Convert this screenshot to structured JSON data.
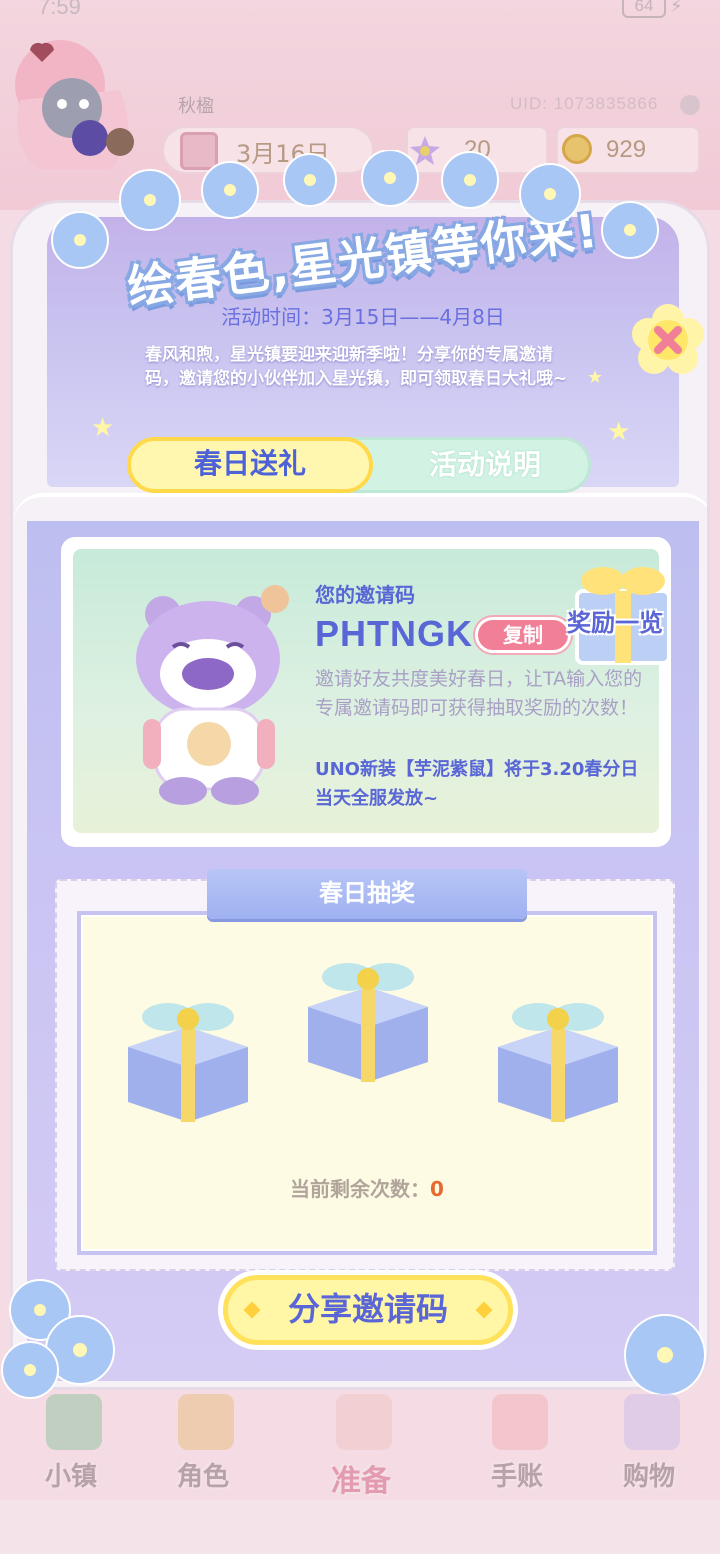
{
  "status": {
    "time": "7:59",
    "battery": "64"
  },
  "hud": {
    "username": "秋楹",
    "uid": "UID: 1073835866",
    "date": "3月16日",
    "gems": "20",
    "coins": "929"
  },
  "event": {
    "title": "绘春色,星光镇等你来!",
    "time": "活动时间：3月15日——4月8日",
    "intro": "春风和煦，星光镇要迎来迎新季啦！分享你的专属邀请码，邀请您的小伙伴加入星光镇，即可领取春日大礼哦~"
  },
  "tabs": {
    "active": "春日送礼",
    "inactive": "活动说明"
  },
  "invite": {
    "label": "您的邀请码",
    "code": "PHTNGK",
    "copy": "复制",
    "desc": "邀请好友共度美好春日，让TA输入您的专属邀请码即可获得抽取奖励的次数！",
    "note": "UNO新装【芋泥紫鼠】将于3.20春分日当天全服发放~"
  },
  "lottery": {
    "title": "春日抽奖",
    "reward_list": "奖励一览",
    "remain_label": "当前剩余次数：",
    "remain_count": "0"
  },
  "share_button": "分享邀请码",
  "nav": {
    "town": "小镇",
    "character": "角色",
    "prepare": "准备",
    "journal": "手账",
    "shop": "购物"
  },
  "colors": {
    "accent_blue": "#5866d6",
    "accent_yellow": "#ffe15c",
    "copy_pink": "#f07f97",
    "count_orange": "#e8692e"
  }
}
